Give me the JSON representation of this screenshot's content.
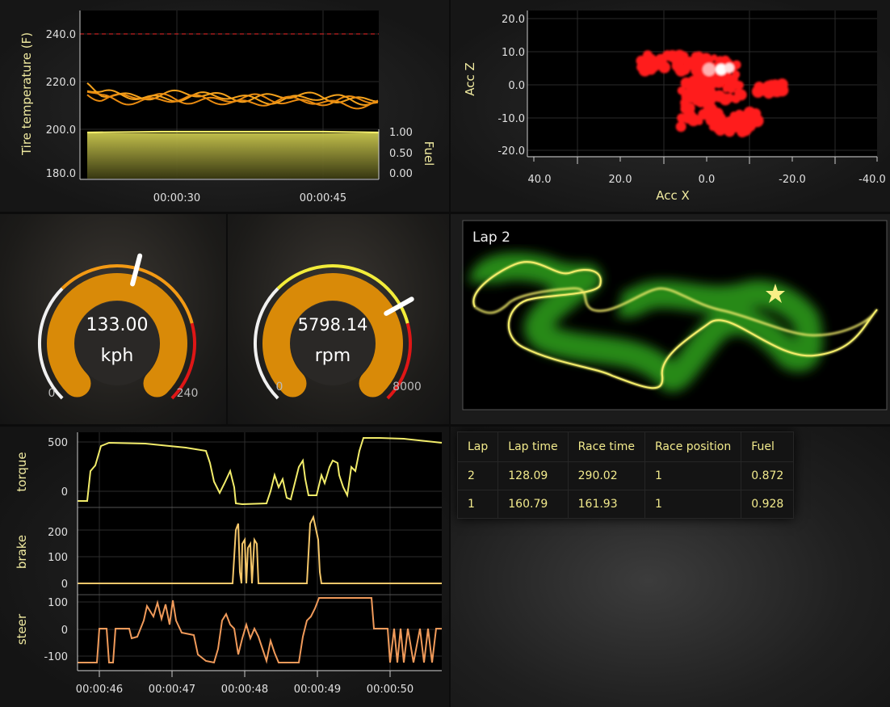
{
  "tire_chart": {
    "ylabel": "Tire temperature (F)",
    "y_ticks": [
      "240.0",
      "220.0",
      "200.0",
      "180.0"
    ],
    "fuel_label": "Fuel",
    "fuel_ticks": [
      "1.00",
      "0.50",
      "0.00"
    ],
    "x_ticks": [
      "00:00:30",
      "00:00:45"
    ]
  },
  "acc_chart": {
    "xlabel": "Acc X",
    "ylabel": "Acc Z",
    "y_ticks": [
      "20.0",
      "10.0",
      "0.0",
      "-10.0",
      "-20.0"
    ],
    "x_ticks": [
      "40.0",
      "20.0",
      "0.0",
      "-20.0",
      "-40.0"
    ]
  },
  "speed_gauge": {
    "value": "133.00",
    "unit": "kph",
    "min": "0",
    "max": "240",
    "fraction": 0.554
  },
  "rpm_gauge": {
    "value": "5798.14",
    "unit": "rpm",
    "min": "0",
    "max": "8000",
    "fraction": 0.725
  },
  "track": {
    "title": "Lap 2",
    "marker_icon": "star-icon"
  },
  "signals_chart": {
    "torque_label": "torque",
    "brake_label": "brake",
    "steer_label": "steer",
    "torque_ticks": [
      "500",
      "0"
    ],
    "brake_ticks": [
      "200",
      "100",
      "0"
    ],
    "steer_ticks": [
      "100",
      "0",
      "-100"
    ],
    "x_ticks": [
      "00:00:46",
      "00:00:47",
      "00:00:48",
      "00:00:49",
      "00:00:50"
    ]
  },
  "lap_table": {
    "headers": [
      "Lap",
      "Lap time",
      "Race time",
      "Race position",
      "Fuel"
    ],
    "rows": [
      [
        "2",
        "128.09",
        "290.02",
        "1",
        "0.872"
      ],
      [
        "1",
        "160.79",
        "161.93",
        "1",
        "0.928"
      ]
    ]
  },
  "colors": {
    "orange": "#f39a14",
    "yellow": "#f2ec6a",
    "red": "#ff1d1d",
    "green": "#2a9c1a",
    "steer": "#f09a5a",
    "label": "#f0eaa0"
  }
}
